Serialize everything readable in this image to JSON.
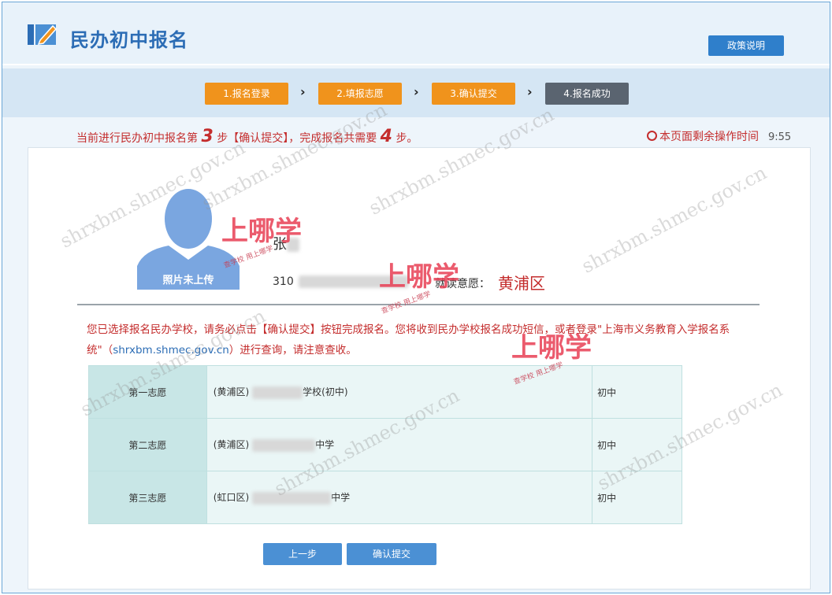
{
  "header": {
    "title": "民办初中报名",
    "policy_button": "政策说明"
  },
  "steps": [
    {
      "label": "1.报名登录",
      "state": "done"
    },
    {
      "label": "2.填报志愿",
      "state": "done"
    },
    {
      "label": "3.确认提交",
      "state": "current"
    },
    {
      "label": "4.报名成功",
      "state": "pending"
    }
  ],
  "step_separator": "›",
  "progress": {
    "prefix": "当前进行民办初中报名第",
    "current_step": "3",
    "middle": "步【确认提交】，完成报名共需要",
    "total_steps": "4",
    "suffix": "步。"
  },
  "timer": {
    "label": "本页面剩余操作时间",
    "value": "9:55"
  },
  "student": {
    "photo_caption": "照片未上传",
    "name": "张",
    "id_prefix": "310",
    "choice_label": "就读意愿：",
    "choice_value": "黄浦区"
  },
  "notice": {
    "part1": "您已选择报名民办学校，请务必点击【确认提交】按钮完成报名。您将收到民办学校报名成功短信，或者登录\"上海市义务教育入学报名系统\"（",
    "link": "shrxbm.shmec.gov.cn",
    "part2": "）进行查询，请注意查收。"
  },
  "choices": [
    {
      "label": "第一志愿",
      "district": "(黄浦区)",
      "school_suffix": "学校(初中)",
      "level": "初中"
    },
    {
      "label": "第二志愿",
      "district": "(黄浦区)",
      "school_suffix": "中学",
      "level": "初中"
    },
    {
      "label": "第三志愿",
      "district": "(虹口区)",
      "school_suffix": "中学",
      "level": "初中"
    }
  ],
  "buttons": {
    "prev": "上一步",
    "confirm": "确认提交"
  },
  "watermarks": {
    "url": "shrxbm.shmec.gov.cn",
    "brand": "上哪学",
    "brand_sub": "查学校 用上哪学"
  },
  "colors": {
    "accent_blue": "#2c6db5",
    "step_orange": "#f0931c",
    "step_grey": "#5a6470",
    "alert_red": "#c42d2d"
  }
}
